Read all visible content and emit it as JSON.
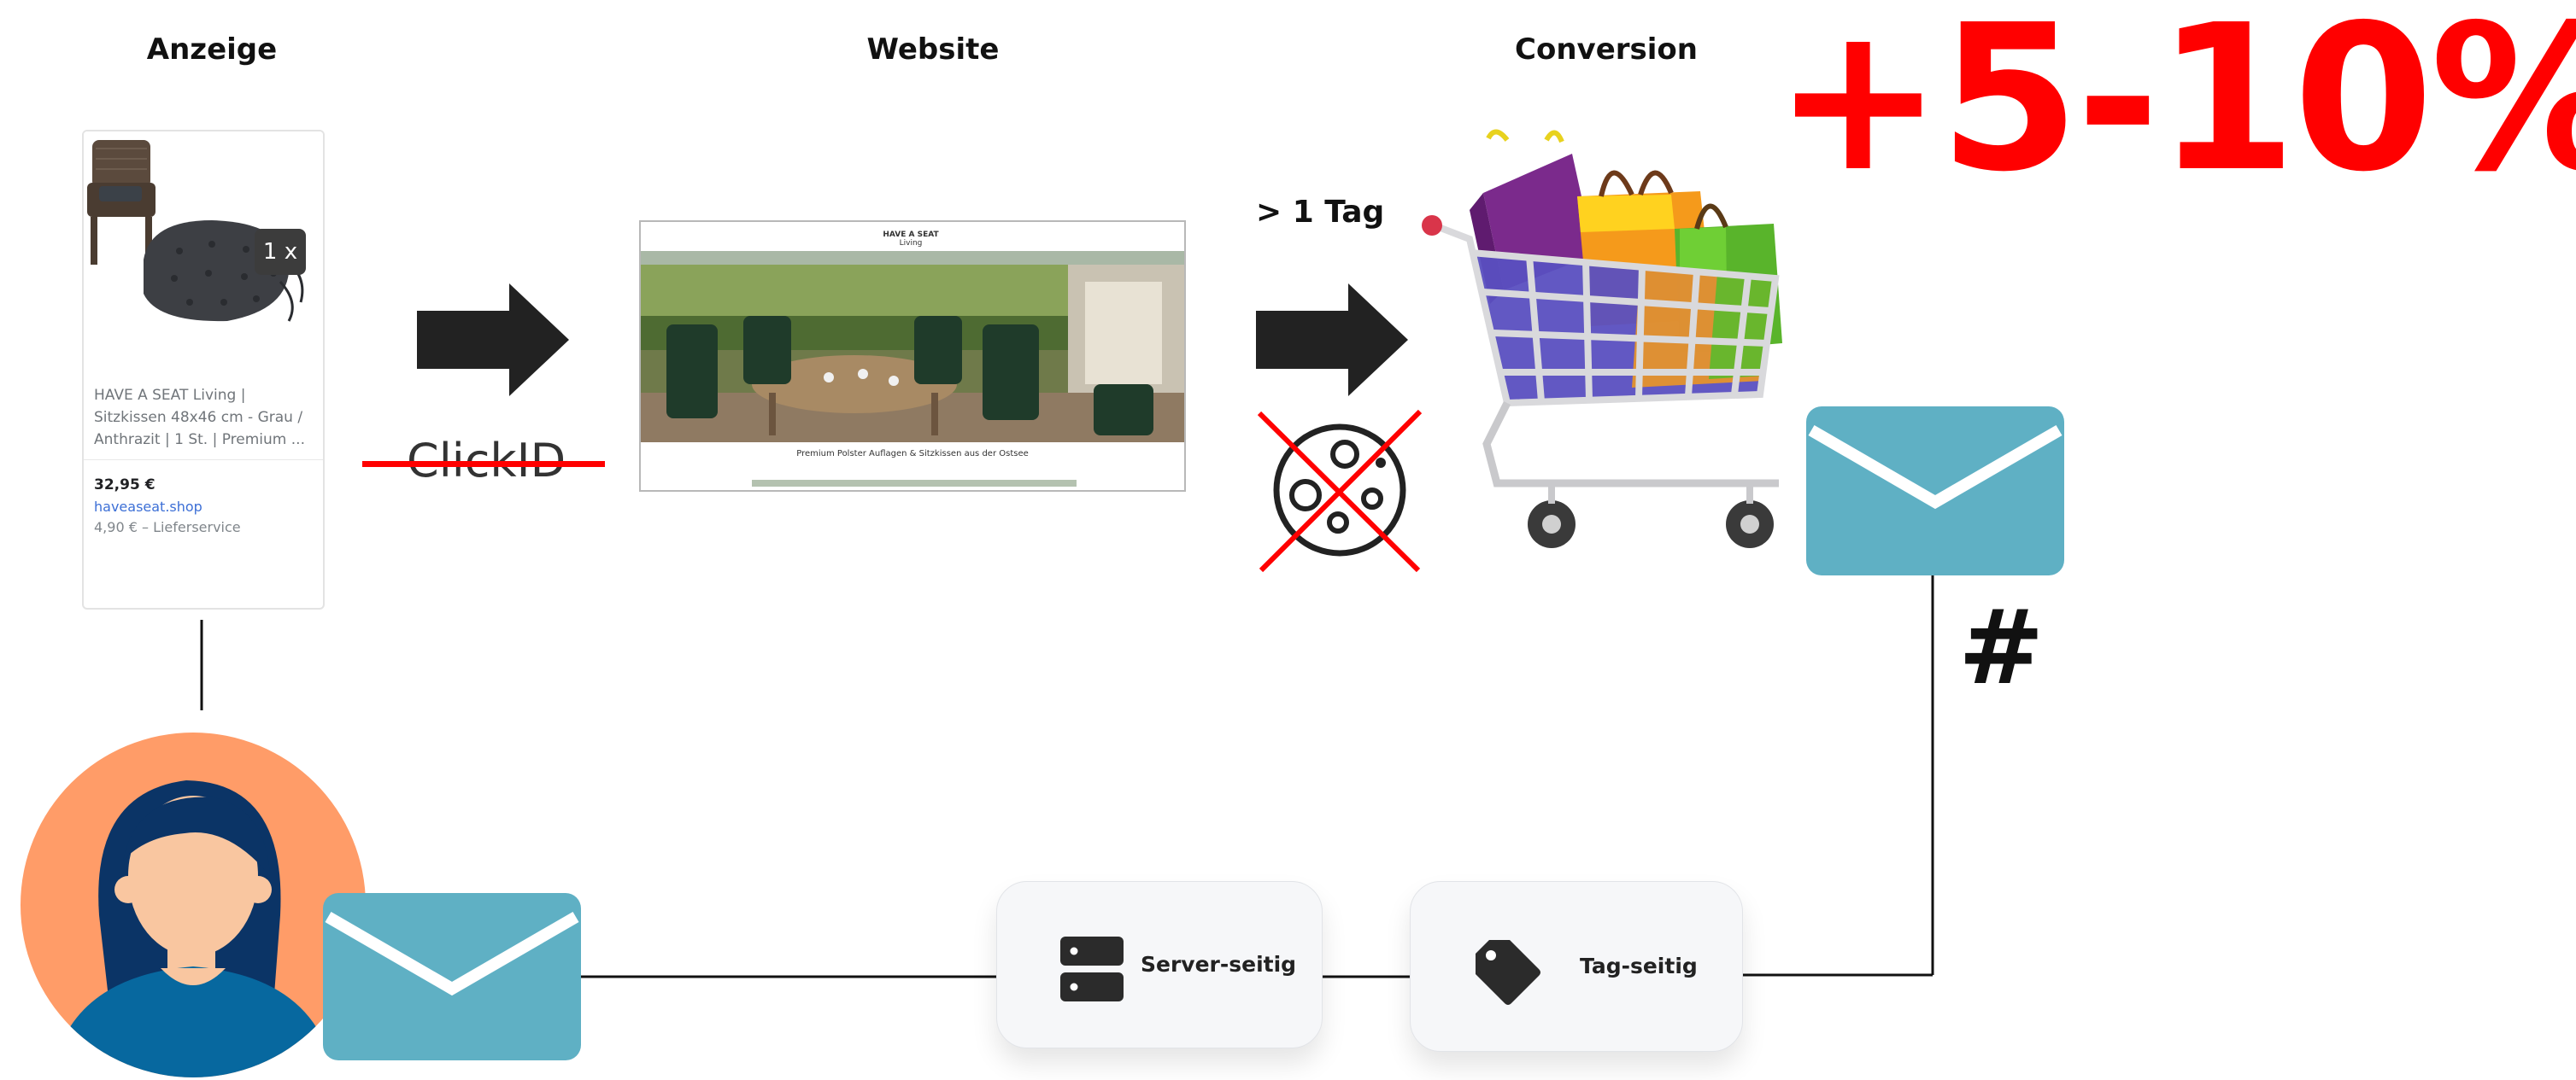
{
  "headings": {
    "ad": "Anzeige",
    "website": "Website",
    "conversion": "Conversion"
  },
  "uplift": "+5-10%",
  "ad_card": {
    "badge": "1 x",
    "title": "HAVE A SEAT Living | Sitzkissen 48x46 cm - Grau / Anthrazit | 1 St. | Premium ...",
    "price": "32,95 €",
    "shop": "haveaseat.shop",
    "shipping": "4,90 € – Lieferservice"
  },
  "clickid_label": "ClickID",
  "website_screenshot": {
    "logo_line1": "HAVE A SEAT",
    "logo_line2": "Living",
    "caption": "Premium Polster Auflagen & Sitzkissen aus der Ostsee"
  },
  "delay_label": "> 1 Tag",
  "hash_label": "#",
  "server_side_label": "Server-seitig",
  "tag_side_label": "Tag-seitig",
  "icons": {
    "arrow_1": "arrow-right-icon",
    "arrow_2": "arrow-right-icon",
    "cookie": "cookie-crossed-icon",
    "cart": "shopping-cart-icon",
    "mail_top": "envelope-icon",
    "mail_bottom": "envelope-icon",
    "person": "person-avatar-icon",
    "server": "server-icon",
    "tag": "tag-icon"
  },
  "colors": {
    "accent_red": "#ff0000",
    "envelope": "#5fb0c4",
    "avatar_bg": "#ff9c68",
    "line": "#111111"
  }
}
